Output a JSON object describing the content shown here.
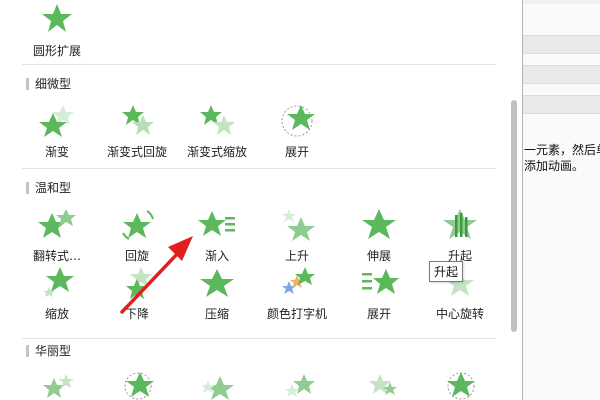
{
  "colors": {
    "star": "#5cb85c",
    "star_light": "#a8d8a8",
    "arrow": "#e02020",
    "accent_blue": "#7aa7e0",
    "accent_orange": "#f0b060"
  },
  "background_panel": {
    "line1": "一元素，然后单击",
    "line2": "添加动画。"
  },
  "gallery": {
    "top_item": {
      "label": "圆形扩展",
      "icon": "star-icon"
    },
    "sections": [
      {
        "title": "细微型",
        "items": [
          {
            "label": "渐变",
            "icon": "star-fade-icon"
          },
          {
            "label": "渐变式回旋",
            "icon": "star-spin-fade-icon"
          },
          {
            "label": "渐变式缩放",
            "icon": "star-zoom-fade-icon"
          },
          {
            "label": "展开",
            "icon": "star-expand-icon"
          }
        ]
      },
      {
        "title": "温和型",
        "items": [
          {
            "label": "翻转式…",
            "icon": "star-flip-icon"
          },
          {
            "label": "回旋",
            "icon": "star-spin-icon"
          },
          {
            "label": "渐入",
            "icon": "star-ease-in-icon"
          },
          {
            "label": "上升",
            "icon": "star-rise-icon"
          },
          {
            "label": "伸展",
            "icon": "star-stretch-icon"
          },
          {
            "label": "升起",
            "icon": "star-rise-up-icon"
          },
          {
            "label": "缩放",
            "icon": "star-zoom-icon"
          },
          {
            "label": "下降",
            "icon": "star-descend-icon"
          },
          {
            "label": "压缩",
            "icon": "star-compress-icon"
          },
          {
            "label": "颜色打字机",
            "icon": "star-color-type-icon"
          },
          {
            "label": "展开",
            "icon": "star-unfold-icon"
          },
          {
            "label": "中心旋转",
            "icon": "star-center-spin-icon"
          }
        ]
      },
      {
        "title": "华丽型",
        "items": []
      }
    ]
  },
  "tooltip": {
    "text": "升起"
  }
}
